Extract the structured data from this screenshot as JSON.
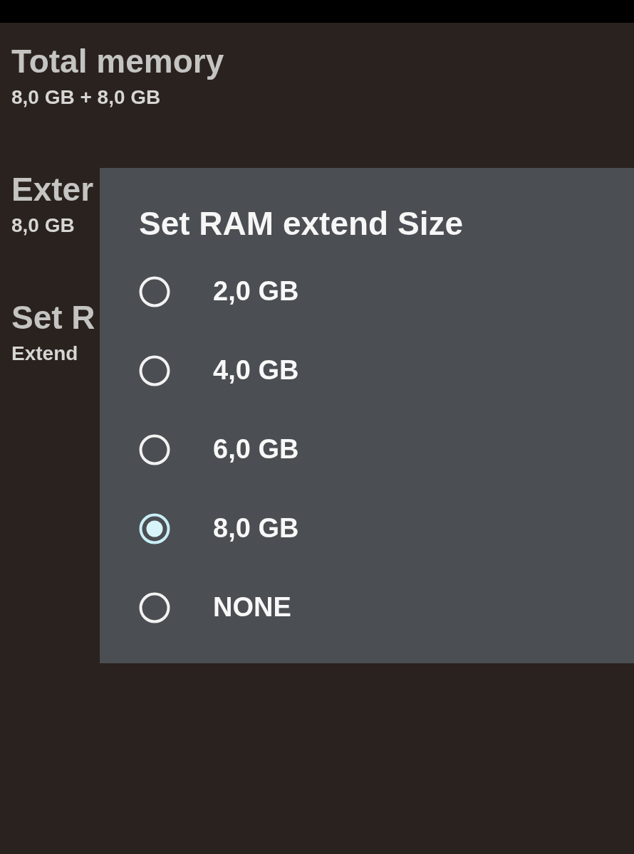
{
  "settings": [
    {
      "title": "Total memory",
      "summary": "8,0 GB + 8,0 GB"
    },
    {
      "title": "Exter",
      "summary": "8,0 GB"
    },
    {
      "title": "Set R",
      "summary": "Extend"
    }
  ],
  "dialog": {
    "title": "Set RAM extend Size",
    "options": [
      {
        "label": "2,0 GB",
        "selected": false
      },
      {
        "label": "4,0 GB",
        "selected": false
      },
      {
        "label": "6,0 GB",
        "selected": false
      },
      {
        "label": "8,0 GB",
        "selected": true
      },
      {
        "label": "NONE",
        "selected": false
      }
    ]
  }
}
